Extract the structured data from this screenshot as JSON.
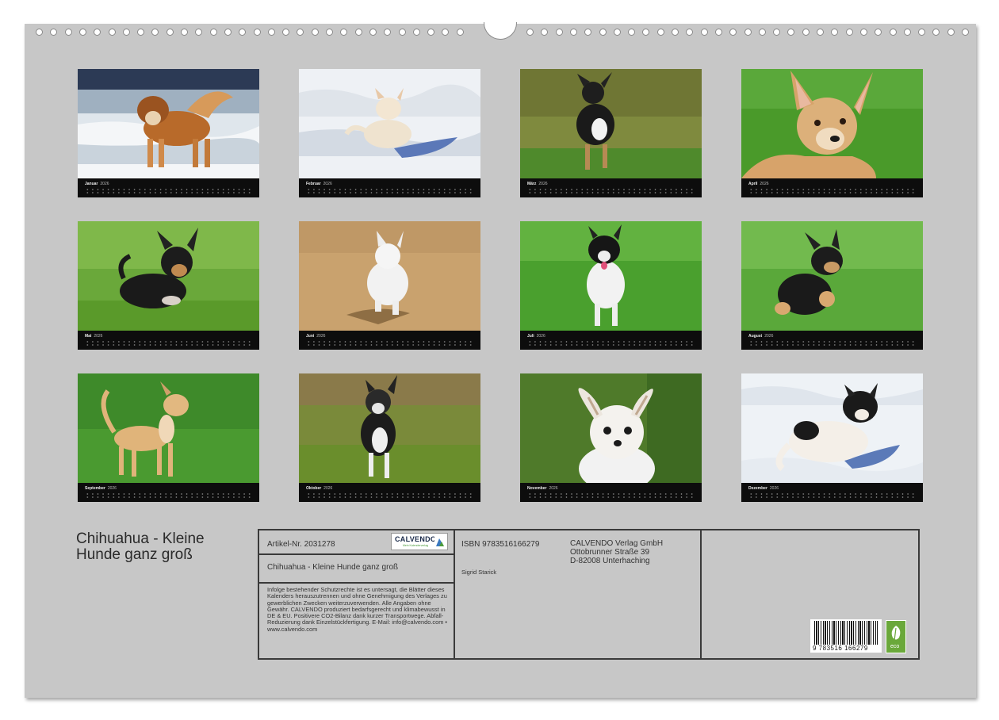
{
  "months": [
    {
      "name": "Januar",
      "year": "2026"
    },
    {
      "name": "Februar",
      "year": "2026"
    },
    {
      "name": "März",
      "year": "2026"
    },
    {
      "name": "April",
      "year": "2026"
    },
    {
      "name": "Mai",
      "year": "2026"
    },
    {
      "name": "Juni",
      "year": "2026"
    },
    {
      "name": "Juli",
      "year": "2026"
    },
    {
      "name": "August",
      "year": "2026"
    },
    {
      "name": "September",
      "year": "2026"
    },
    {
      "name": "Oktober",
      "year": "2026"
    },
    {
      "name": "November",
      "year": "2026"
    },
    {
      "name": "Dezember",
      "year": "2026"
    }
  ],
  "title_line1": "Chihuahua - Kleine",
  "title_line2": "Hunde ganz groß",
  "info": {
    "article": "Artikel-Nr. 2031278",
    "logo": "CALVENDO",
    "logo_sub": "Mein Kalenderverlag",
    "product_title": "Chihuahua - Kleine Hunde ganz groß",
    "legal_text": "Infolge bestehender Schutzrechte ist es untersagt, die Blätter dieses Kalenders herauszutrennen und ohne Genehmigung des Verlages zu gewerblichen Zwecken weiterzuverwenden. Alle Angaben ohne Gewähr. CALVENDO produziert bedarfsgerecht und klimabewusst in DE & EU. Positivere CO2-Bilanz dank kurzer Transportwege. Abfall-Reduzierung dank Einzelstückfertigung. E-Mail: info@calvendo.com • www.calvendo.com",
    "isbn": "ISBN 9783516166279",
    "author": "Sigrid Starick",
    "publisher_line1": "CALVENDO Verlag GmbH",
    "publisher_line2": "Ottobrunner Straße 39",
    "publisher_line3": "D-82008 Unterhaching",
    "barcode_number": "9 783516 166279",
    "eco_label": "eco"
  },
  "colors": {
    "sheet": "#c7c7c7",
    "calendar_bar": "#0d0d0d",
    "frame": "#3a3a3a",
    "eco_green": "#6aa83a"
  },
  "photos": [
    {
      "background": "snow-and-sea",
      "dog": "long-haired sable chihuahua standing"
    },
    {
      "background": "snow",
      "dog": "cream chihuahua running"
    },
    {
      "background": "grass",
      "dog": "black tricolor long-haired chihuahua running"
    },
    {
      "background": "green",
      "dog": "fawn chihuahua portrait"
    },
    {
      "background": "grass",
      "dog": "black and tan chihuahua lying"
    },
    {
      "background": "sand",
      "dog": "white chihuahua running"
    },
    {
      "background": "grass",
      "dog": "black and white chihuahua running"
    },
    {
      "background": "grass",
      "dog": "black and tan chihuahua sitting"
    },
    {
      "background": "clover grass",
      "dog": "fawn chihuahua standing side"
    },
    {
      "background": "field",
      "dog": "black and white chihuahua walking"
    },
    {
      "background": "green blur",
      "dog": "white long-haired chihuahua portrait"
    },
    {
      "background": "snow",
      "dog": "black and white long-haired chihuahua in snow"
    }
  ]
}
